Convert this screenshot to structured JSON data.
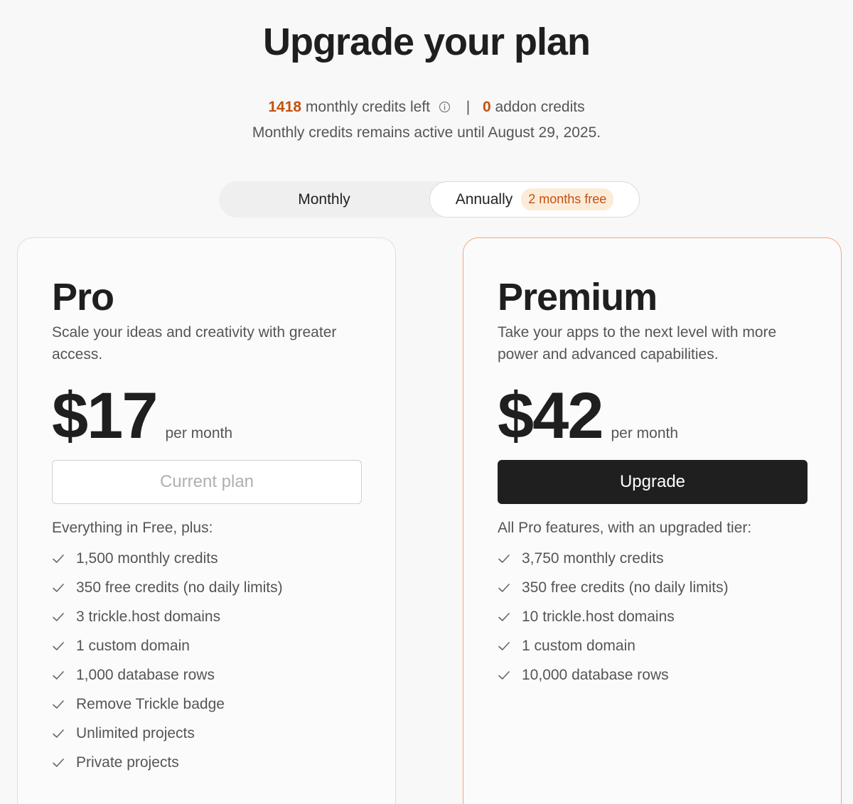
{
  "page_title": "Upgrade your plan",
  "credits": {
    "monthly_left": "1418",
    "monthly_label": "monthly credits left",
    "separator": "|",
    "addon": "0",
    "addon_label": "addon credits",
    "expiry": "Monthly credits remains active until August 29, 2025."
  },
  "billing_toggle": {
    "monthly_label": "Monthly",
    "annual_label": "Annually",
    "annual_badge": "2 months free",
    "selected": "Annually"
  },
  "plans": [
    {
      "name": "Pro",
      "description": "Scale your ideas and creativity with greater access.",
      "price": "$17",
      "per": "per month",
      "button_label": "Current plan",
      "features_heading": "Everything in Free, plus:",
      "features": [
        "1,500 monthly credits",
        "350 free credits (no daily limits)",
        "3 trickle.host domains",
        "1 custom domain",
        "1,000 database rows",
        "Remove Trickle badge",
        "Unlimited projects",
        "Private projects"
      ]
    },
    {
      "name": "Premium",
      "description": "Take your apps to the next level with more power and advanced capabilities.",
      "price": "$42",
      "per": "per month",
      "button_label": "Upgrade",
      "features_heading": "All Pro features, with an upgraded tier:",
      "features": [
        "3,750 monthly credits",
        "350 free credits (no daily limits)",
        "10 trickle.host domains",
        "1 custom domain",
        "10,000 database rows"
      ]
    }
  ],
  "colors": {
    "accent": "#c2520f",
    "badge_bg": "#fdebd9",
    "premium_border": "#f0a77a",
    "primary_button": "#1f1f1f"
  },
  "icons": {
    "info": "info-circle-icon",
    "check": "check-icon"
  }
}
